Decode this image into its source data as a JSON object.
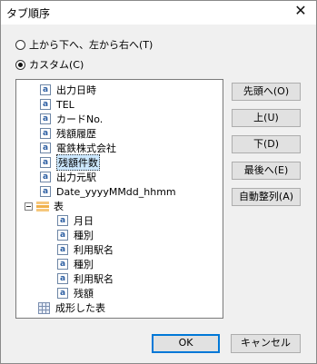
{
  "window": {
    "title": "タブ順序",
    "close_glyph": "✕"
  },
  "options": {
    "radio1_label": "上から下へ、左から右へ(T)",
    "radio2_label": "カスタム(C)"
  },
  "tree": {
    "items": [
      "出力日時",
      "TEL",
      "カードNo.",
      "残額履歴",
      "電鉄株式会社",
      "残額件数",
      "出力元駅",
      "Date_yyyyMMdd_hhmm",
      "表",
      "月日",
      "種別",
      "利用駅名",
      "種別",
      "利用駅名",
      "残額",
      "成形した表"
    ]
  },
  "buttons": {
    "to_top": "先頭へ(O)",
    "up": "上(U)",
    "down": "下(D)",
    "to_bottom": "最後へ(E)",
    "auto_arrange": "自動整列(A)",
    "ok": "OK",
    "cancel": "キャンセル"
  },
  "colors": {
    "selection": "#cce8ff",
    "accent": "#0078d7"
  }
}
